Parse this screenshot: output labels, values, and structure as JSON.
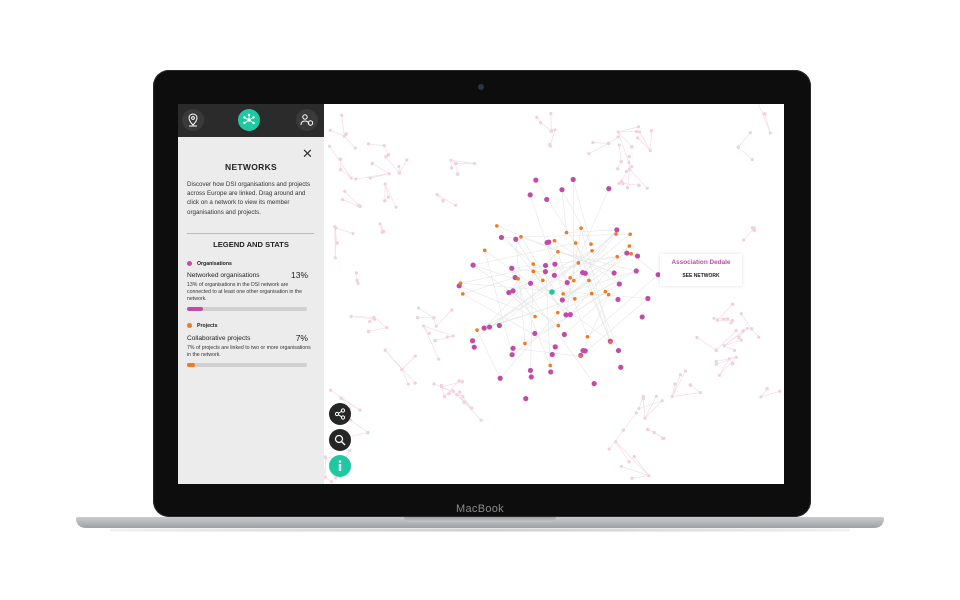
{
  "device": {
    "brand_label": "MacBook"
  },
  "toolbar": {
    "icons": [
      "map-pin-icon",
      "network-icon",
      "organisations-icon"
    ],
    "active": "network-icon",
    "accent": "#1fc8a0"
  },
  "panel": {
    "title": "NETWORKS",
    "intro": "Discover how DSI organisations and projects across Europe are linked. Drag around and click on a network to view its member organisations and projects.",
    "legend_title": "LEGEND AND STATS",
    "organisations": {
      "category": "Organisations",
      "color": "#c24aa8",
      "stat_label": "Networked organisations",
      "stat_value": "13%",
      "fraction": 0.13,
      "description": "13% of organisations in the DSI network are connected to at least one other organisation in the network."
    },
    "projects": {
      "category": "Projects",
      "color": "#f07a1f",
      "stat_label": "Collaborative projects",
      "stat_value": "7%",
      "fraction": 0.07,
      "description": "7% of projects are linked to two or more organisations in the network."
    }
  },
  "tooltip": {
    "name": "Association Dedale",
    "button_label": "SEE NETWORK"
  },
  "graph": {
    "faded_color": "#f2cfe0",
    "selected_color": "#1fc8a0"
  },
  "actions": {
    "icons": [
      "share-icon",
      "search-icon",
      "info-icon"
    ]
  }
}
